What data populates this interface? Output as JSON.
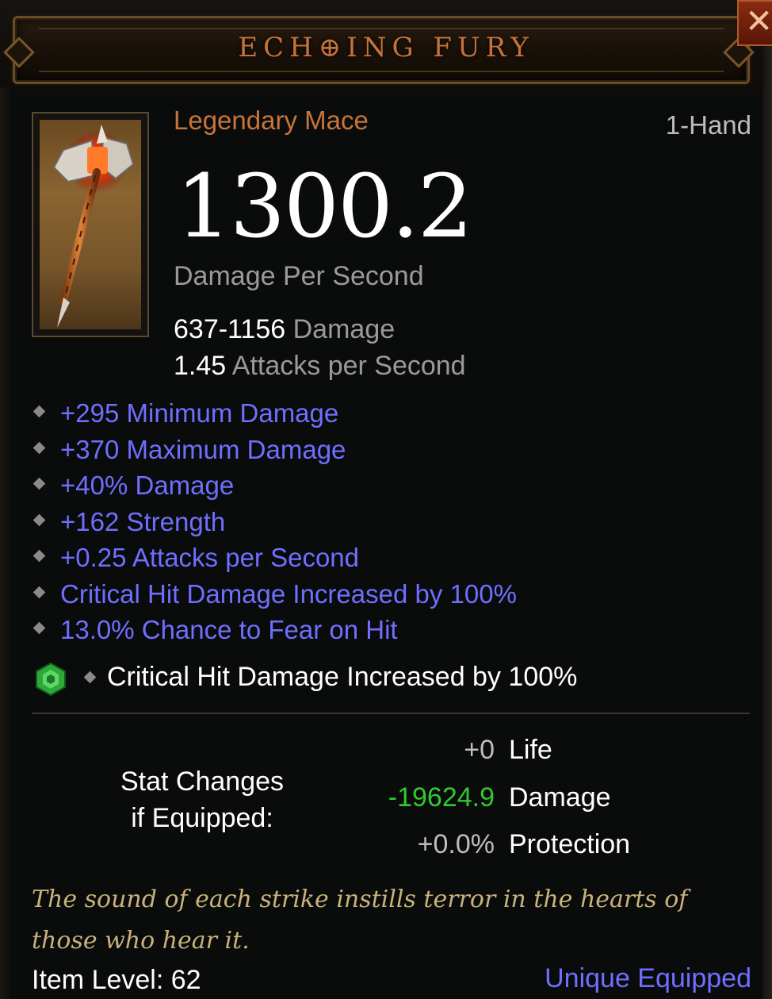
{
  "header": {
    "item_name": "ECH⊕ING FURY",
    "close_label": "✕"
  },
  "item": {
    "icon": "mace-icon",
    "type_line": "Legendary Mace",
    "slot": "1-Hand",
    "dps": "1300.2",
    "dps_label": "Damage Per Second",
    "damage_range": "637-1156",
    "damage_label": "Damage",
    "attack_speed": "1.45",
    "attack_speed_label": "Attacks per Second"
  },
  "affixes": [
    "+295 Minimum Damage",
    "+370 Maximum Damage",
    "+40% Damage",
    "+162 Strength",
    "+0.25 Attacks per Second",
    "Critical Hit Damage Increased by 100%",
    "13.0% Chance to Fear on Hit"
  ],
  "socket": {
    "gem_icon": "emerald-gem-icon",
    "text": "Critical Hit Damage Increased by 100%"
  },
  "stat_changes": {
    "title_line1": "Stat Changes",
    "title_line2": "if Equipped:",
    "rows": [
      {
        "value": "+0",
        "label": "Life",
        "value_color": "#bdbdbd"
      },
      {
        "value": "-19624.9",
        "label": "Damage",
        "value_color": "#32c832"
      },
      {
        "value": "+0.0%",
        "label": "Protection",
        "value_color": "#bdbdbd"
      }
    ]
  },
  "flavor_text": "The sound of each strike instills terror in the hearts of those who hear it.",
  "item_level_label": "Item Level: 62",
  "unique_label": "Unique Equipped",
  "colors": {
    "legendary_orange": "#c8743a",
    "magic_blue": "#6f6fff",
    "flavor_gold": "#c9b27b",
    "negative_green": "#32c832"
  }
}
